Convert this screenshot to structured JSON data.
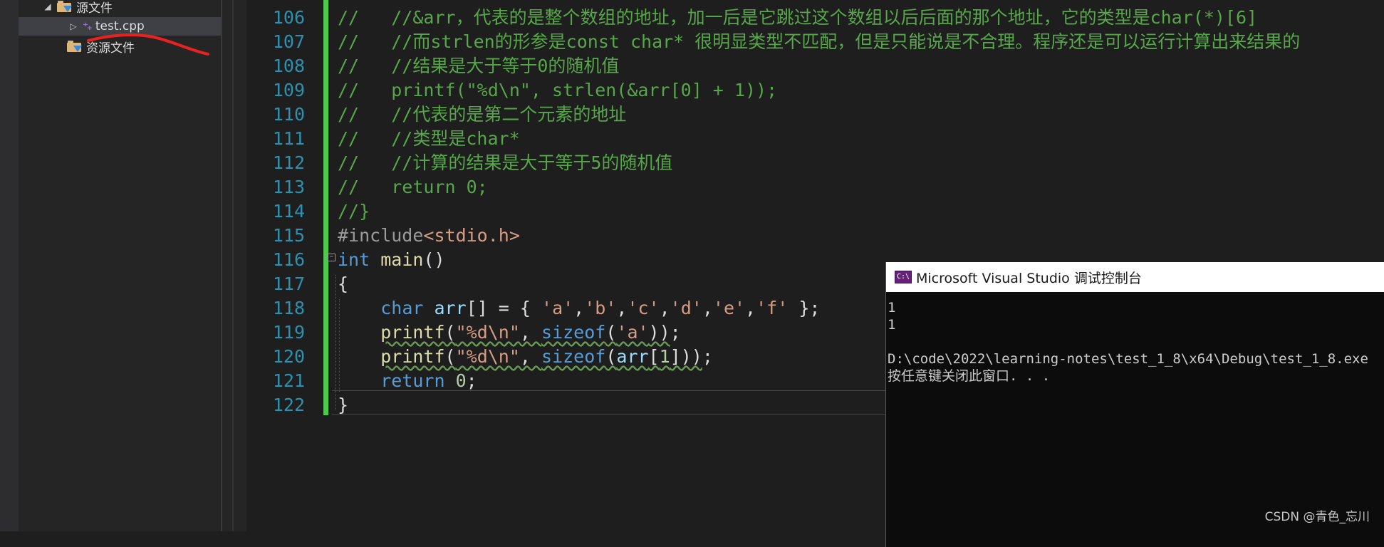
{
  "explorer": {
    "items": [
      {
        "label": "源文件",
        "type": "filter-folder",
        "expanded": true
      },
      {
        "label": "test.cpp",
        "type": "cpp-file",
        "selected": true
      },
      {
        "label": "资源文件",
        "type": "filter-folder"
      }
    ]
  },
  "editor": {
    "lines": [
      {
        "num": "106",
        "tokens": [
          {
            "t": "//   //&arr，代表的是整个数组的地址，加一后是它跳过这个数组以后后面的那个地址，它的类型是char(*)[6]",
            "c": "comment"
          }
        ]
      },
      {
        "num": "107",
        "tokens": [
          {
            "t": "//   //而strlen的形参是const char* 很明显类型不匹配，但是只能说是不合理。程序还是可以运行计算出来结果的",
            "c": "comment"
          }
        ]
      },
      {
        "num": "108",
        "tokens": [
          {
            "t": "//   //结果是大于等于0的随机值",
            "c": "comment"
          }
        ]
      },
      {
        "num": "109",
        "tokens": [
          {
            "t": "//   printf(\"%d\\n\", strlen(&arr[0] + 1));",
            "c": "comment"
          }
        ]
      },
      {
        "num": "110",
        "tokens": [
          {
            "t": "//   //代表的是第二个元素的地址",
            "c": "comment"
          }
        ]
      },
      {
        "num": "111",
        "tokens": [
          {
            "t": "//   //类型是char*",
            "c": "comment"
          }
        ]
      },
      {
        "num": "112",
        "tokens": [
          {
            "t": "//   //计算的结果是大于等于5的随机值",
            "c": "comment"
          }
        ]
      },
      {
        "num": "113",
        "tokens": [
          {
            "t": "//   return 0;",
            "c": "comment"
          }
        ]
      },
      {
        "num": "114",
        "tokens": [
          {
            "t": "//}",
            "c": "comment"
          }
        ]
      },
      {
        "num": "115",
        "tokens": [
          {
            "t": "#include",
            "c": "pre"
          },
          {
            "t": "<stdio.h>",
            "c": "inc"
          }
        ]
      },
      {
        "num": "116",
        "tokens": [
          {
            "t": "int",
            "c": "kw"
          },
          {
            "t": " ",
            "c": "txt"
          },
          {
            "t": "main",
            "c": "fn"
          },
          {
            "t": "()",
            "c": "txt"
          }
        ]
      },
      {
        "num": "117",
        "tokens": [
          {
            "t": "{",
            "c": "txt"
          }
        ]
      },
      {
        "num": "118",
        "tokens": [
          {
            "t": "    ",
            "c": "txt"
          },
          {
            "t": "char",
            "c": "kw"
          },
          {
            "t": " ",
            "c": "txt"
          },
          {
            "t": "arr",
            "c": "var"
          },
          {
            "t": "[] = { ",
            "c": "txt"
          },
          {
            "t": "'a'",
            "c": "str"
          },
          {
            "t": ",",
            "c": "txt"
          },
          {
            "t": "'b'",
            "c": "str"
          },
          {
            "t": ",",
            "c": "txt"
          },
          {
            "t": "'c'",
            "c": "str"
          },
          {
            "t": ",",
            "c": "txt"
          },
          {
            "t": "'d'",
            "c": "str"
          },
          {
            "t": ",",
            "c": "txt"
          },
          {
            "t": "'e'",
            "c": "str"
          },
          {
            "t": ",",
            "c": "txt"
          },
          {
            "t": "'f'",
            "c": "str"
          },
          {
            "t": " };",
            "c": "txt"
          }
        ]
      },
      {
        "num": "119",
        "tokens": [
          {
            "t": "    ",
            "c": "txt"
          },
          {
            "t": "printf",
            "c": "fn",
            "squig": true
          },
          {
            "t": "(",
            "c": "txt",
            "squig": true
          },
          {
            "t": "\"%d\\n\"",
            "c": "str",
            "squig": true
          },
          {
            "t": ", ",
            "c": "txt",
            "squig": true
          },
          {
            "t": "sizeof",
            "c": "kw",
            "squig": true
          },
          {
            "t": "(",
            "c": "txt",
            "squig": true
          },
          {
            "t": "'a'",
            "c": "str",
            "squig": true
          },
          {
            "t": "))",
            "c": "txt",
            "squig": true
          },
          {
            "t": ";",
            "c": "txt"
          }
        ]
      },
      {
        "num": "120",
        "tokens": [
          {
            "t": "    ",
            "c": "txt"
          },
          {
            "t": "printf",
            "c": "fn",
            "squig": true
          },
          {
            "t": "(",
            "c": "txt",
            "squig": true
          },
          {
            "t": "\"%d\\n\"",
            "c": "str",
            "squig": true
          },
          {
            "t": ", ",
            "c": "txt",
            "squig": true
          },
          {
            "t": "sizeof",
            "c": "kw",
            "squig": true
          },
          {
            "t": "(",
            "c": "txt",
            "squig": true
          },
          {
            "t": "arr",
            "c": "var",
            "squig": true
          },
          {
            "t": "[",
            "c": "txt",
            "squig": true
          },
          {
            "t": "1",
            "c": "num",
            "squig": true
          },
          {
            "t": "]))",
            "c": "txt",
            "squig": true
          },
          {
            "t": ";",
            "c": "txt"
          }
        ]
      },
      {
        "num": "121",
        "tokens": [
          {
            "t": "    ",
            "c": "txt"
          },
          {
            "t": "return",
            "c": "kw"
          },
          {
            "t": " ",
            "c": "txt"
          },
          {
            "t": "0",
            "c": "num"
          },
          {
            "t": ";",
            "c": "txt"
          }
        ]
      },
      {
        "num": "122",
        "tokens": [
          {
            "t": "}",
            "c": "txt"
          }
        ]
      }
    ]
  },
  "console": {
    "title": "Microsoft Visual Studio 调试控制台",
    "icon": "C:\\",
    "output": "1\n1\n\nD:\\code\\2022\\learning-notes\\test_1_8\\x64\\Debug\\test_1_8.exe\n按任意键关闭此窗口. . ."
  },
  "watermark": "CSDN @青色_忘川",
  "colors": {
    "comment": "#57a64a",
    "keyword": "#569cd6",
    "function": "#dcdcaa",
    "string": "#d69d85",
    "line_number": "#2b91af",
    "change_bar": "#4ec94e",
    "annotation": "#e8231f"
  }
}
